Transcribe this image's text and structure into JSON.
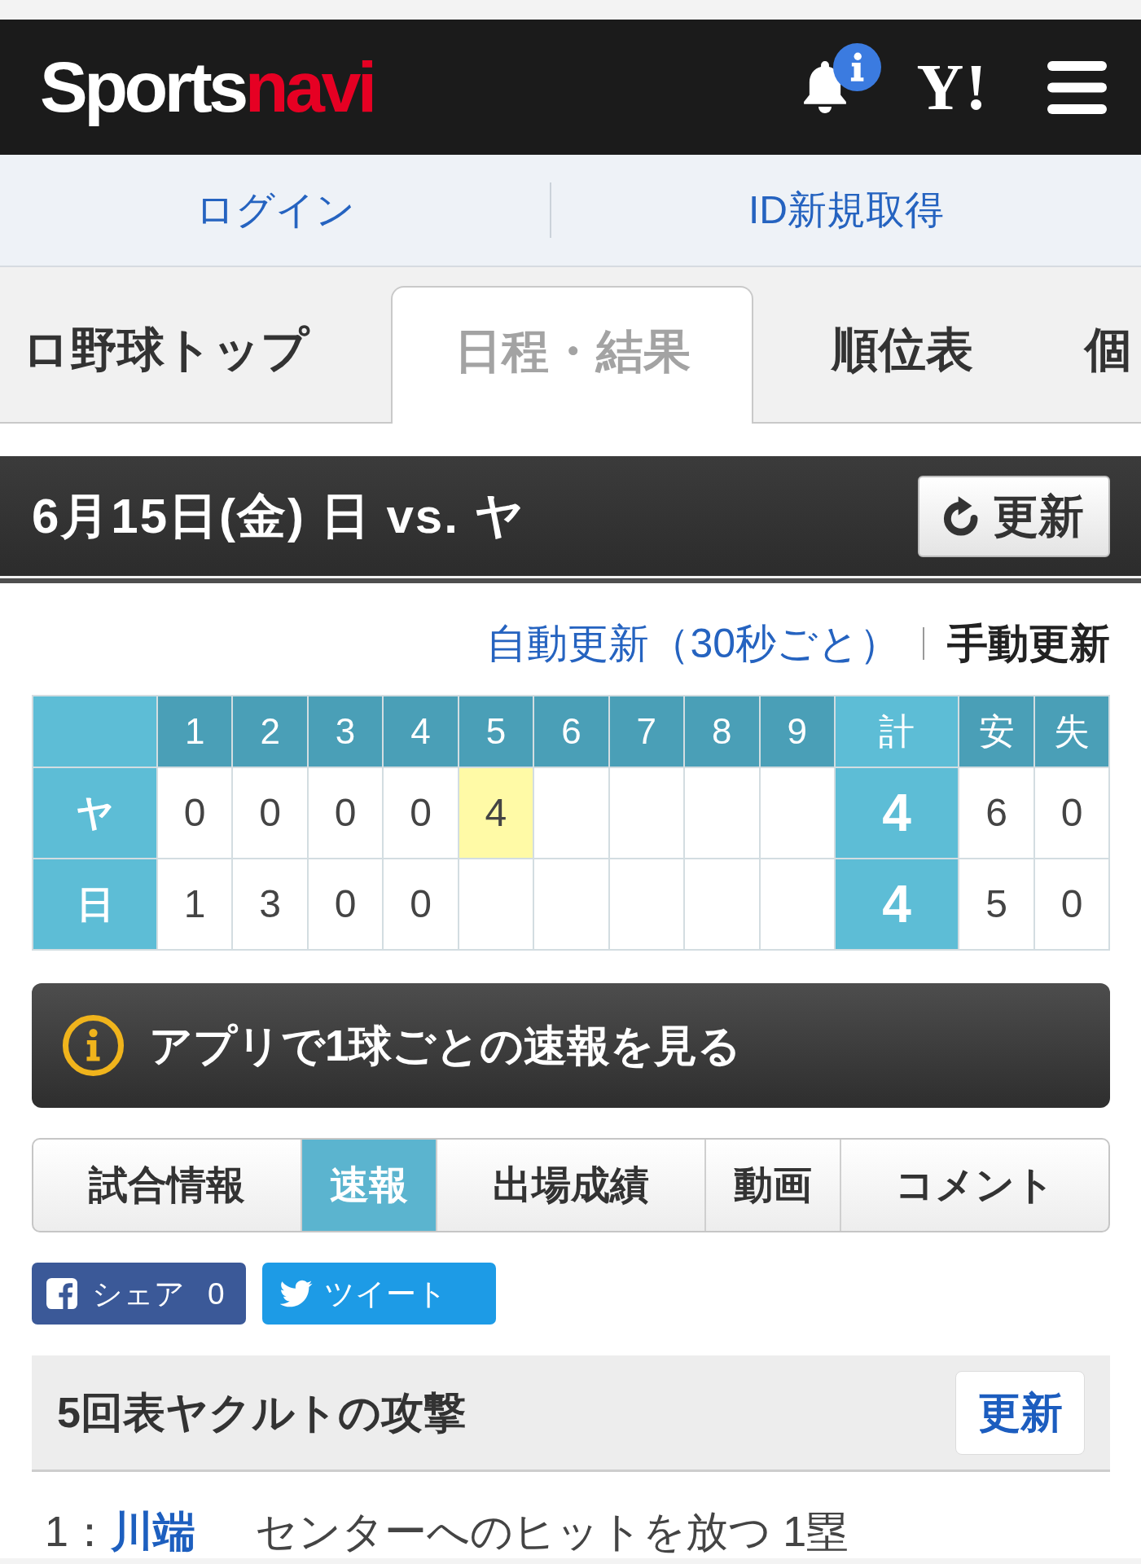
{
  "header": {
    "logo": [
      {
        "text": "Sports",
        "color": "#ffffff"
      },
      {
        "text": "navi",
        "color": "#e60023"
      }
    ],
    "yahoo_logo": "Y!"
  },
  "account_links": [
    "ログイン",
    "ID新規取得"
  ],
  "nav_tabs": [
    {
      "label": "ロ野球トップ",
      "selected": false
    },
    {
      "label": "日程・結果",
      "selected": true
    },
    {
      "label": "順位表",
      "selected": false
    },
    {
      "label": "個",
      "selected": false
    }
  ],
  "game": {
    "title": "6月15日(金) 日 vs. ヤ",
    "refresh_button": "更新"
  },
  "update_modes": [
    {
      "label": "自動更新（30秒ごと）",
      "selected": false
    },
    {
      "label": "手動更新",
      "selected": true
    }
  ],
  "scoreboard": {
    "header": {
      "innings": [
        "1",
        "2",
        "3",
        "4",
        "5",
        "6",
        "7",
        "8",
        "9"
      ],
      "total": "計",
      "hits": "安",
      "errors": "失"
    },
    "rows": [
      {
        "team": "ヤ",
        "innings": [
          {
            "score": "0",
            "current": false
          },
          {
            "score": "0",
            "current": false
          },
          {
            "score": "0",
            "current": false
          },
          {
            "score": "0",
            "current": false
          },
          {
            "score": "4",
            "current": true
          }
        ],
        "total": "4",
        "hits": "6",
        "errors": "0"
      },
      {
        "team": "日",
        "innings": [
          {
            "score": "1",
            "current": false
          },
          {
            "score": "3",
            "current": false
          },
          {
            "score": "0",
            "current": false
          },
          {
            "score": "0",
            "current": false
          }
        ],
        "total": "4",
        "hits": "5",
        "errors": "0"
      }
    ]
  },
  "app_banner": "アプリで1球ごとの速報を見る",
  "section_tabs": [
    {
      "label": "試合情報",
      "selected": false
    },
    {
      "label": "速報",
      "selected": true
    },
    {
      "label": "出場成績",
      "selected": false
    },
    {
      "label": "動画",
      "selected": false
    },
    {
      "label": "コメント",
      "selected": false
    }
  ],
  "share_buttons": [
    {
      "kind": "facebook",
      "label": "シェア",
      "count": "0"
    },
    {
      "kind": "twitter",
      "label": "ツイート"
    }
  ],
  "inning": {
    "title": "5回表ヤクルトの攻撃",
    "refresh_button": "更新"
  },
  "plays": [
    {
      "number": "1：",
      "batter": "川端",
      "result": "センターへのヒットを放つ 1塁"
    }
  ]
}
